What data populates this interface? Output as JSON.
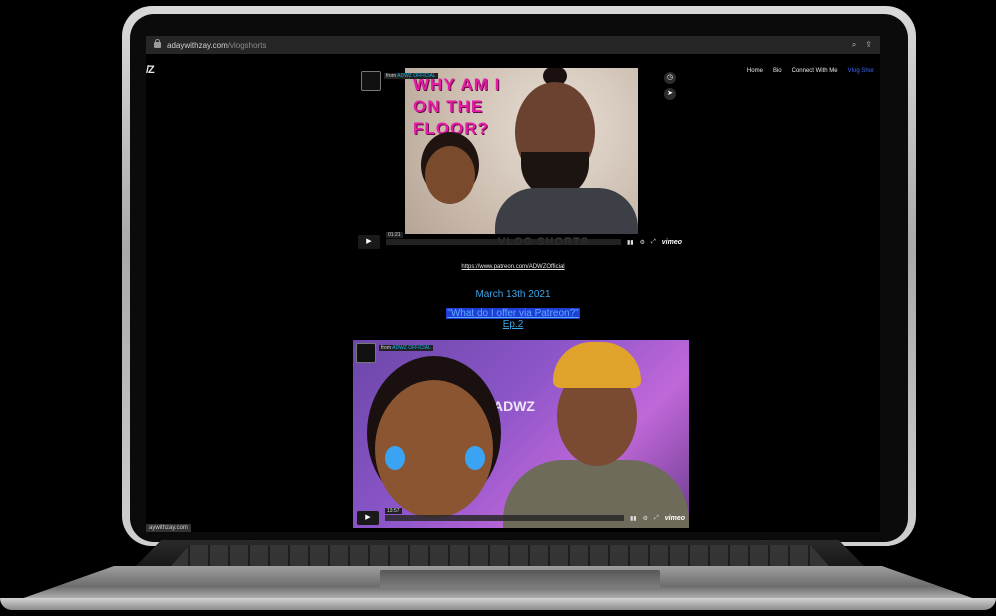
{
  "browser": {
    "url_domain": "adaywithzay.com",
    "url_path": "/vlogshorts"
  },
  "site": {
    "logo": "/Z",
    "nav": [
      {
        "label": "Home"
      },
      {
        "label": "Bio"
      },
      {
        "label": "Connect With Me"
      },
      {
        "label": "Vlog Shor"
      }
    ]
  },
  "video1": {
    "from_prefix": "from",
    "channel": "ADWZ OFFICIAL",
    "title_art": "WHY AM I ON THE FLOOR?",
    "time": "01:21",
    "watermark": "VLOG SHORTS",
    "vimeo": "vimeo"
  },
  "patreon_link": "https://www.patreon.com/ADWZOfficial",
  "date": "March 13th 2021",
  "headline": "\"What do I offer via Patreon?\"",
  "episode": "Ep.2",
  "video2": {
    "from_prefix": "from",
    "channel": "ADWZ OFFICIAL",
    "sign": "ADWZ",
    "time": "13:57",
    "vimeo": "vimeo"
  },
  "status_url": "aywithzay.com",
  "colors": {
    "nav_active": "#3b67f5",
    "date": "#3da6e8",
    "headline_bg": "#1d3fd6",
    "title_art": "#e51ca5"
  }
}
